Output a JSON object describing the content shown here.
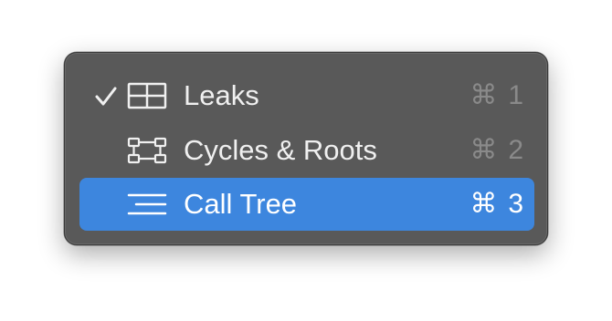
{
  "menu": {
    "items": [
      {
        "label": "Leaks",
        "checked": true,
        "icon": "table-grid-icon",
        "shortcut_symbol": "⌘",
        "shortcut_key": "1",
        "selected": false
      },
      {
        "label": "Cycles & Roots",
        "checked": false,
        "icon": "graph-nodes-icon",
        "shortcut_symbol": "⌘",
        "shortcut_key": "2",
        "selected": false
      },
      {
        "label": "Call Tree",
        "checked": false,
        "icon": "call-tree-icon",
        "shortcut_symbol": "⌘",
        "shortcut_key": "3",
        "selected": true
      }
    ]
  },
  "colors": {
    "menu_background": "#595959",
    "highlight": "#3d86de",
    "text": "#f0f0f0",
    "shortcut_text": "#8a8a8a"
  }
}
